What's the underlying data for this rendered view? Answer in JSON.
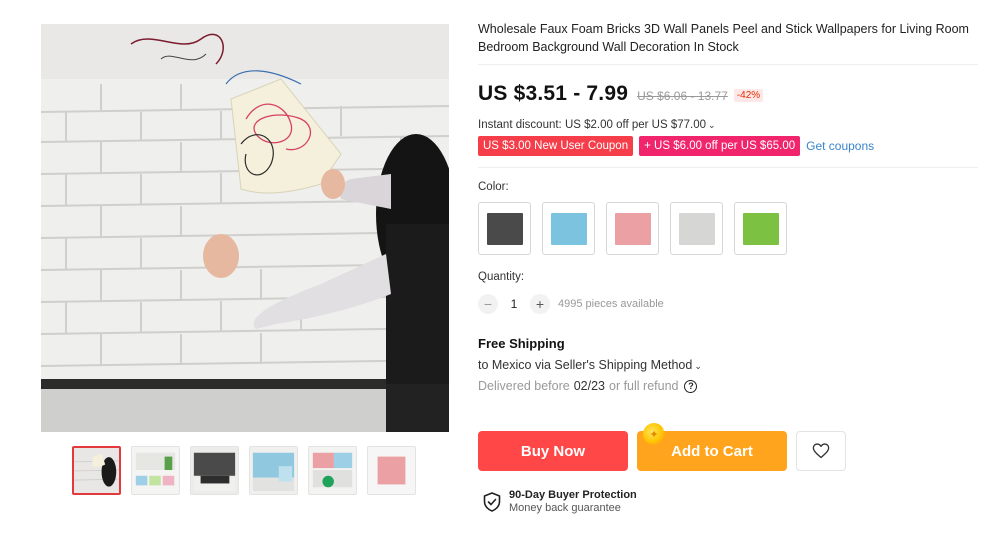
{
  "product": {
    "title": "Wholesale Faux Foam Bricks 3D Wall Panels Peel and Stick Wallpapers for Living Room Bedroom Background Wall Decoration In Stock"
  },
  "pricing": {
    "price": "US $3.51 - 7.99",
    "original_price": "US $6.06 - 13.77",
    "discount": "-42%"
  },
  "promotions": {
    "instant_discount": "Instant discount: US $2.00 off per US $77.00",
    "coupons": [
      "US $3.00 New User Coupon",
      "US $6.00 off per US $65.00"
    ],
    "get_coupons": "Get coupons"
  },
  "options": {
    "color_label": "Color:",
    "colors": [
      {
        "name": "dark-gray",
        "hex": "#4a4a4a"
      },
      {
        "name": "light-blue",
        "hex": "#7cc3df"
      },
      {
        "name": "pink",
        "hex": "#eba0a3"
      },
      {
        "name": "light-gray",
        "hex": "#d6d6d4"
      },
      {
        "name": "green",
        "hex": "#7dc142"
      }
    ],
    "quantity_label": "Quantity:",
    "quantity": "1",
    "stock_text": "4995 pieces available"
  },
  "shipping": {
    "title": "Free Shipping",
    "method": "to Mexico via Seller's Shipping Method",
    "delivered_prefix": "Delivered before",
    "delivered_date": "02/23",
    "delivered_suffix": "or full refund"
  },
  "actions": {
    "buy_now": "Buy Now",
    "add_to_cart": "Add to Cart"
  },
  "protection": {
    "title": "90-Day Buyer Protection",
    "subtitle": "Money back guarantee"
  },
  "colors": {
    "buy_now": "#ff4747",
    "add_to_cart": "#ffa41c",
    "coupon_red": "#f63e4a",
    "coupon_pink": "#f1256b",
    "link_blue": "#3a85c9"
  },
  "icons": {
    "help": "question-circle-icon",
    "wishlist": "heart-outline-icon",
    "protection": "shield-check-icon",
    "caret": "chevron-down-icon"
  }
}
